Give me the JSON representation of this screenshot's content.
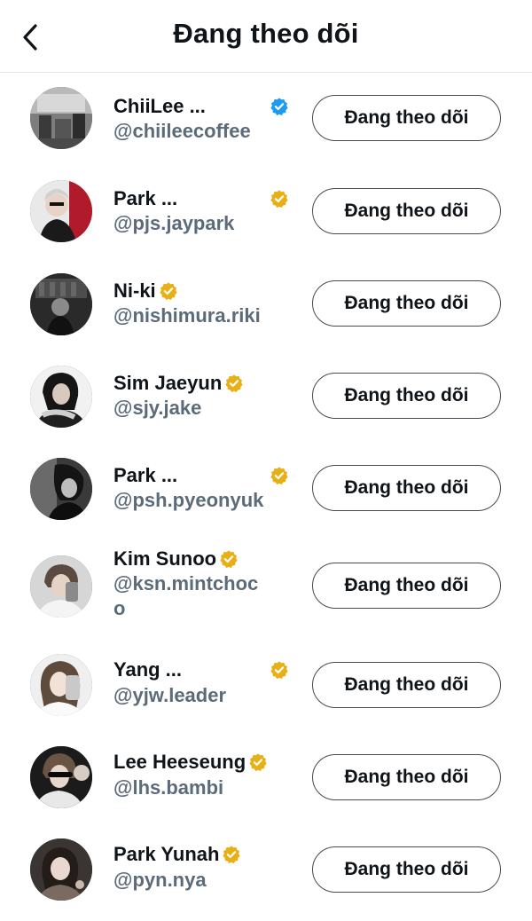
{
  "header": {
    "title": "Đang theo dõi"
  },
  "follow_label": "Đang theo dõi",
  "colors": {
    "verified_blue": "#1d9bf0",
    "verified_gold": "#e8b015",
    "handle_gray": "#5b6b7a"
  },
  "accounts": [
    {
      "name": "ChiiLee ...",
      "handle": "@chiileecoffee",
      "badge": "verified-blue"
    },
    {
      "name": "Park ...",
      "handle": "@pjs.jaypark",
      "badge": "verified-gold"
    },
    {
      "name": "Ni-ki",
      "handle": "@nishimura.riki",
      "badge": "verified-gold"
    },
    {
      "name": "Sim Jaeyun",
      "handle": "@sjy.jake",
      "badge": "verified-gold"
    },
    {
      "name": "Park ...",
      "handle": "@psh.pyeonyuk",
      "badge": "verified-gold"
    },
    {
      "name": "Kim Sunoo",
      "handle": "@ksn.mintchoc",
      "handle_cont": "o",
      "badge": "verified-gold"
    },
    {
      "name": "Yang ...",
      "handle": "@yjw.leader",
      "badge": "verified-gold"
    },
    {
      "name": "Lee Heeseung",
      "handle": "@lhs.bambi",
      "badge": "verified-gold"
    },
    {
      "name": "Park Yunah",
      "handle": "@pyn.nya",
      "badge": "verified-gold"
    }
  ]
}
